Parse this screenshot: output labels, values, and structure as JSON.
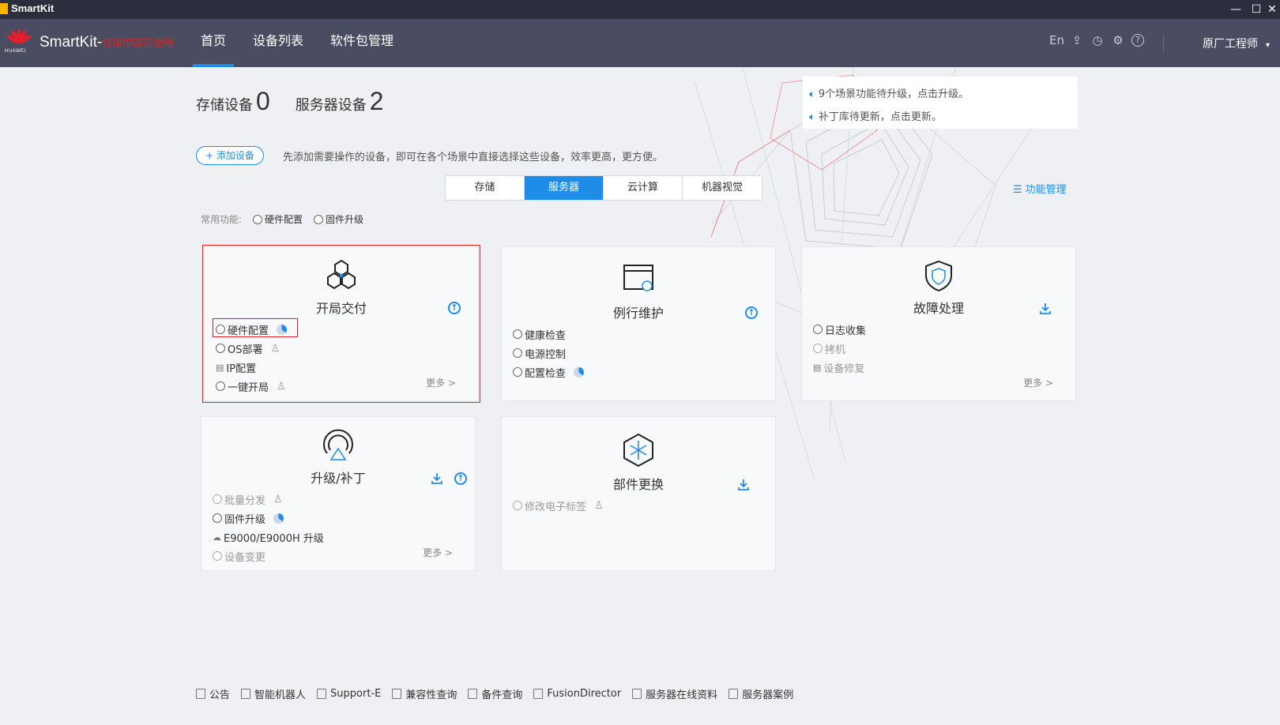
{
  "window": {
    "title": "SmartKit",
    "minimize": "—",
    "maximize": "☐",
    "close": "✕"
  },
  "header": {
    "brand": "HUAWEI",
    "app_name": "SmartKit-",
    "app_suffix": "仅限中国区使用",
    "nav": [
      {
        "label": "首页",
        "active": true
      },
      {
        "label": "设备列表",
        "active": false
      },
      {
        "label": "软件包管理",
        "active": false
      }
    ],
    "icons": [
      {
        "name": "language-toggle",
        "glyph": "En"
      },
      {
        "name": "upload-icon",
        "glyph": "⇪"
      },
      {
        "name": "clock-icon",
        "glyph": "◷"
      },
      {
        "name": "gear-icon",
        "glyph": "⚙"
      },
      {
        "name": "help-icon",
        "glyph": "?"
      }
    ],
    "user": "原厂工程师",
    "user_caret": "▾"
  },
  "counters": {
    "storage_label": "存储设备",
    "storage_count": "0",
    "server_label": "服务器设备",
    "server_count": "2"
  },
  "notices": [
    "9个场景功能待升级，点击升级。",
    "补丁库待更新，点击更新。"
  ],
  "add_device": {
    "label": "+ 添加设备",
    "hint": "先添加需要操作的设备，即可在各个场景中直接选择这些设备，效率更高，更方便。"
  },
  "tabs": [
    {
      "label": "存储",
      "active": false
    },
    {
      "label": "服务器",
      "active": true
    },
    {
      "label": "云计算",
      "active": false
    },
    {
      "label": "机器视觉",
      "active": false
    }
  ],
  "function_management": "功能管理",
  "common_functions": {
    "label": "常用功能:",
    "options": [
      "硬件配置",
      "固件升级"
    ]
  },
  "cards": {
    "deploy": {
      "title": "开局交付",
      "items": [
        {
          "label": "硬件配置",
          "marker": "radio",
          "extra": "pie"
        },
        {
          "label": "OS部署",
          "marker": "radio",
          "extra": "person"
        },
        {
          "label": "IP配置",
          "marker": "db",
          "extra": ""
        },
        {
          "label": "一键开局",
          "marker": "radio",
          "extra": "person"
        }
      ],
      "more": "更多 >"
    },
    "maintenance": {
      "title": "例行维护",
      "items": [
        {
          "label": "健康检查",
          "marker": "radio",
          "extra": ""
        },
        {
          "label": "电源控制",
          "marker": "radio",
          "extra": ""
        },
        {
          "label": "配置检查",
          "marker": "radio",
          "extra": "pie"
        }
      ]
    },
    "fault": {
      "title": "故障处理",
      "items": [
        {
          "label": "日志收集",
          "marker": "radio",
          "extra": "",
          "dim": false
        },
        {
          "label": "拷机",
          "marker": "radio",
          "extra": "",
          "dim": true
        },
        {
          "label": "设备修复",
          "marker": "db",
          "extra": "",
          "dim": true
        }
      ],
      "more": "更多 >"
    },
    "upgrade": {
      "title": "升级/补丁",
      "items": [
        {
          "label": "批量分发",
          "marker": "radio",
          "extra": "person",
          "dim": true
        },
        {
          "label": "固件升级",
          "marker": "radio",
          "extra": "pie",
          "dim": false
        },
        {
          "label": "E9000/E9000H 升级",
          "marker": "cloud",
          "extra": "",
          "dim": false
        },
        {
          "label": "设备变更",
          "marker": "radio",
          "extra": "",
          "dim": true
        }
      ],
      "more": "更多 >"
    },
    "replace": {
      "title": "部件更换",
      "items": [
        {
          "label": "修改电子标签",
          "marker": "radio",
          "extra": "person",
          "dim": true
        }
      ]
    }
  },
  "footer": [
    "公告",
    "智能机器人",
    "Support-E",
    "兼容性查询",
    "备件查询",
    "FusionDirector",
    "服务器在线资料",
    "服务器案例"
  ],
  "colors": {
    "accent": "#1f8de8",
    "header_bg": "#4a4c62",
    "titlebar_bg": "#2b2e3d",
    "highlight": "#e02020"
  }
}
